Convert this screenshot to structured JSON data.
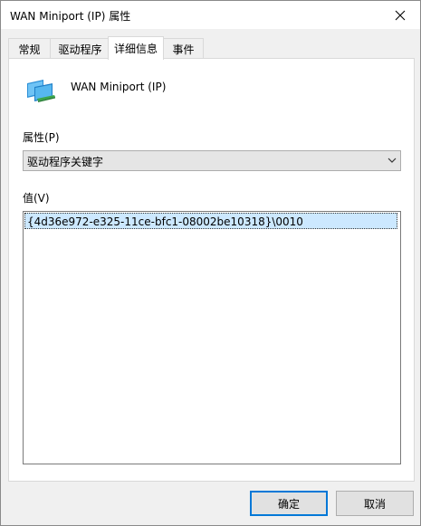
{
  "window": {
    "title": "WAN Miniport (IP) 属性"
  },
  "tabs": [
    {
      "label": "常规",
      "active": false
    },
    {
      "label": "驱动程序",
      "active": false
    },
    {
      "label": "详细信息",
      "active": true
    },
    {
      "label": "事件",
      "active": false
    }
  ],
  "device": {
    "icon": "network-adapter-icon",
    "name": "WAN Miniport (IP)"
  },
  "property": {
    "label": "属性(P)",
    "selected": "驱动程序关键字"
  },
  "value": {
    "label": "值(V)",
    "items": [
      "{4d36e972-e325-11ce-bfc1-08002be10318}\\0010"
    ]
  },
  "buttons": {
    "ok": "确定",
    "cancel": "取消"
  },
  "colors": {
    "selection": "#cce8ff",
    "focus_border": "#0078d7"
  }
}
